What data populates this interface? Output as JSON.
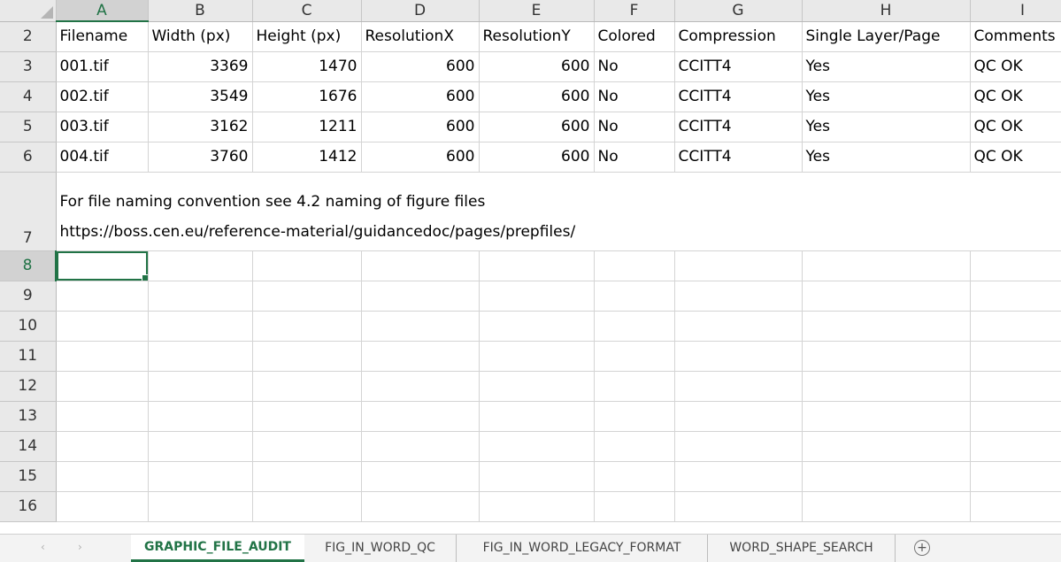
{
  "sheet": {
    "corner": "",
    "columns": [
      "A",
      "B",
      "C",
      "D",
      "E",
      "F",
      "G",
      "H",
      "I"
    ],
    "active_column": "A",
    "active_row": "8",
    "rows": [
      {
        "num": "2",
        "cells": [
          "Filename",
          "Width (px)",
          "Height (px)",
          "ResolutionX",
          "ResolutionY",
          "Colored",
          "Compression",
          "Single Layer/Page",
          "Comments"
        ]
      },
      {
        "num": "3",
        "cells": [
          "001.tif",
          "3369",
          "1470",
          "600",
          "600",
          "No",
          "CCITT4",
          "Yes",
          "QC OK"
        ]
      },
      {
        "num": "4",
        "cells": [
          "002.tif",
          "3549",
          "1676",
          "600",
          "600",
          "No",
          "CCITT4",
          "Yes",
          "QC OK"
        ]
      },
      {
        "num": "5",
        "cells": [
          "003.tif",
          "3162",
          "1211",
          "600",
          "600",
          "No",
          "CCITT4",
          "Yes",
          "QC OK"
        ]
      },
      {
        "num": "6",
        "cells": [
          "004.tif",
          "3760",
          "1412",
          "600",
          "600",
          "No",
          "CCITT4",
          "Yes",
          "QC OK"
        ]
      }
    ],
    "note_row": {
      "num": "7",
      "line1": "For file naming convention see 4.2 naming of figure files",
      "line2": "https://boss.cen.eu/reference-material/guidancedoc/pages/prepfiles/"
    },
    "empty_rows": [
      "8",
      "9",
      "10",
      "11",
      "12",
      "13",
      "14",
      "15",
      "16"
    ]
  },
  "tabs": {
    "prev_icon": "‹",
    "next_icon": "›",
    "items": [
      {
        "label": "GRAPHIC_FILE_AUDIT",
        "active": true
      },
      {
        "label": "FIG_IN_WORD_QC",
        "active": false
      },
      {
        "label": "FIG_IN_WORD_LEGACY_FORMAT",
        "active": false
      },
      {
        "label": "WORD_SHAPE_SEARCH",
        "active": false
      }
    ],
    "add_icon": "+"
  },
  "colors": {
    "accent": "#217346",
    "header_bg": "#e9e9e9",
    "gridline": "#d4d4d4"
  }
}
